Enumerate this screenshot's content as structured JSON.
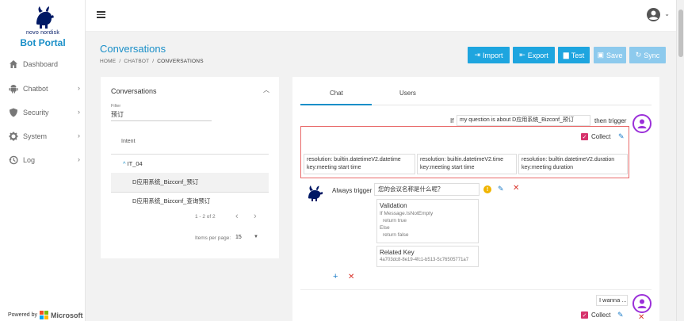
{
  "sidebar": {
    "brand_small": "novo nordisk",
    "brand_title": "Bot Portal",
    "items": [
      {
        "label": "Dashboard",
        "icon": "dashboard-icon",
        "has_chevron": false
      },
      {
        "label": "Chatbot",
        "icon": "android-icon",
        "has_chevron": true
      },
      {
        "label": "Security",
        "icon": "shield-icon",
        "has_chevron": true
      },
      {
        "label": "System",
        "icon": "gear-icon",
        "has_chevron": true
      },
      {
        "label": "Log",
        "icon": "history-icon",
        "has_chevron": true
      }
    ],
    "powered_by": "Powered by",
    "powered_brand": "Microsoft"
  },
  "header": {
    "page_title": "Conversations",
    "breadcrumb": [
      "HOME",
      "CHATBOT",
      "CONVERSATIONS"
    ],
    "breadcrumb_sep": "/"
  },
  "toolbar": {
    "import": "Import",
    "export": "Export",
    "test": "Test",
    "save": "Save",
    "sync": "Sync"
  },
  "left_panel": {
    "title": "Conversations",
    "filter_label": "Filter",
    "filter_value": "预订",
    "column_intent": "Intent",
    "group": "IT_04",
    "rows": [
      "D应用系统_Bizconf_预订",
      "D应用系统_Bizconf_查询预订"
    ],
    "pager_range": "1 - 2 of 2",
    "items_per_page_label": "Items per page:",
    "items_per_page": "15"
  },
  "right_panel": {
    "tabs": [
      "Chat",
      "Users"
    ],
    "trigger_if": "If",
    "trigger_value": "my question is about D应用系统_Bizconf_预订",
    "trigger_then": "then trigger",
    "collect_label": "Collect",
    "resolutions": [
      {
        "line1": "resolution: builtin.datetimeV2.datetime",
        "line2": "key:meeting start time"
      },
      {
        "line1": "resolution: builtin.datetimeV2.time",
        "line2": "key:meeting start time"
      },
      {
        "line1": "resolution: builtin.datetimeV2.duration",
        "line2": "key:meeting duration"
      }
    ],
    "always_trigger_label": "Always trigger",
    "always_trigger_value": "您的会议名称是什么呢？",
    "validation": {
      "title": "Validation",
      "line1": "If Message.IsNotEmpty",
      "line2": "return true",
      "line3": "Else",
      "line4": "return false"
    },
    "related_key": {
      "title": "Related Key",
      "value": "4a703dc8-8e19-4fc1-b513-5c76505771a7"
    },
    "second_input": "I wanna ...",
    "second_collect_label": "Collect"
  },
  "colors": {
    "accent": "#1ea5df",
    "accent_disabled": "#8dcaed",
    "avatar_purple": "#9b30d9",
    "danger": "#d9342b",
    "checkbox": "#d6336c"
  }
}
